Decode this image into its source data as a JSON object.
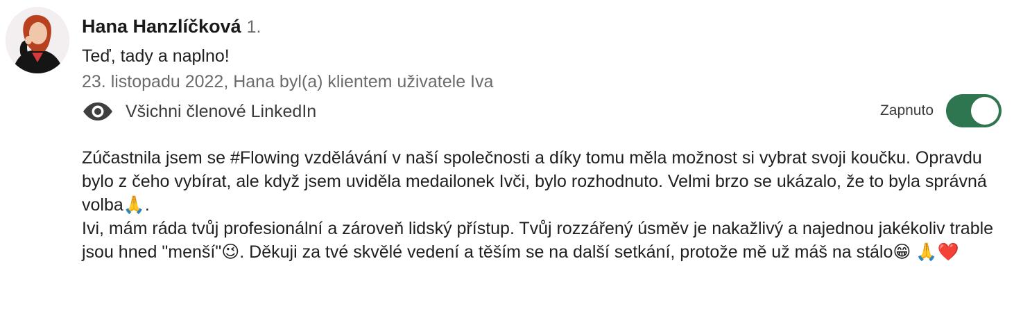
{
  "recommendation": {
    "author": {
      "name": "Hana Hanzlíčková",
      "degree": "1.",
      "headline": "Teď, tady a naplno!",
      "avatar_icon": "profile-photo"
    },
    "meta": "23. listopadu 2022, Hana byl(a) klientem uživatele Iva",
    "visibility": {
      "icon": "eye-icon",
      "label": "Všichni členové LinkedIn"
    },
    "toggle": {
      "label": "Zapnuto",
      "state": "on",
      "color": "#2e7650"
    },
    "paragraph_1": "Zúčastnila jsem se #Flowing vzdělávání v naší společnosti a díky tomu měla možnost si vybrat svoji koučku. Opravdu bylo z čeho vybírat, ale když jsem uviděla medailonek Ivči, bylo rozhodnuto. Velmi brzo se ukázalo, že to byla správná volba",
    "paragraph_1_emoji": "🙏",
    "paragraph_1_end": ".",
    "paragraph_2_a": "Ivi, mám ráda tvůj profesionální a zároveň lidský přístup. Tvůj rozzářený úsměv je nakažlivý a najednou jakékoliv trable jsou hned \"menší\"",
    "paragraph_2_emoji_1": "😉",
    "paragraph_2_b": ". Děkuji za tvé skvělé vedení a těším se na další setkání, protože mě už máš na stálo",
    "paragraph_2_emoji_2": "😁",
    "paragraph_2_emoji_3": "🙏",
    "paragraph_2_emoji_4": "❤️"
  }
}
